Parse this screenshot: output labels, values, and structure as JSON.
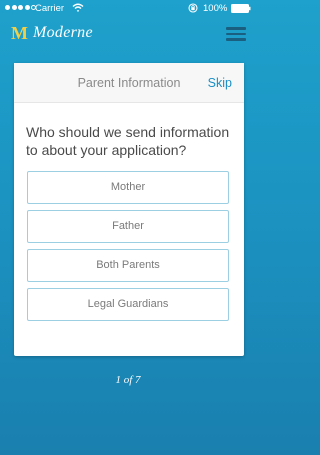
{
  "status_bar": {
    "carrier": "Carrier",
    "battery": "100%",
    "signal_dots": 4,
    "signal_total": 5
  },
  "app": {
    "logo_mark": "M",
    "name": "Moderne",
    "logo_color": "#f2cf44"
  },
  "card": {
    "title": "Parent Information",
    "skip_label": "Skip",
    "question": "Who should we send information to about your application?",
    "options": [
      "Mother",
      "Father",
      "Both Parents",
      "Legal Guardians"
    ]
  },
  "pager": {
    "current": "1",
    "of_label": "of",
    "total": "7"
  },
  "colors": {
    "accent": "#1b8fc4",
    "option_border": "#9dcfe2",
    "background_top": "#1ea1cc",
    "background_bottom": "#1a7fae"
  },
  "icons": {
    "menu": "hamburger-menu-icon",
    "wifi": "wifi-icon",
    "rotation": "rotation-lock-icon",
    "battery": "battery-icon"
  }
}
